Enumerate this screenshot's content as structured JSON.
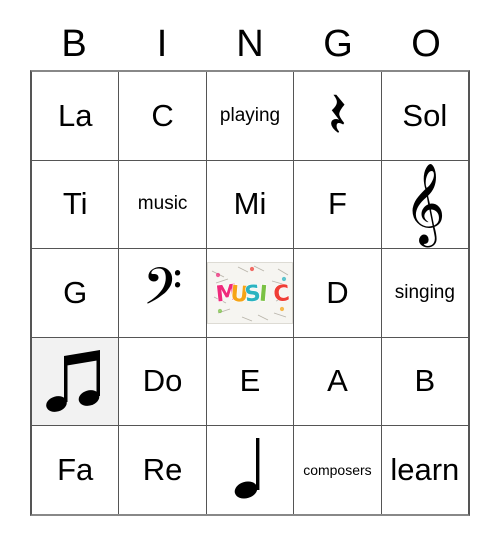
{
  "card": {
    "type": "bingo-card",
    "headers": [
      "B",
      "I",
      "N",
      "G",
      "O"
    ],
    "rows": [
      [
        {
          "kind": "text",
          "value": "La",
          "size": "large"
        },
        {
          "kind": "text",
          "value": "C",
          "size": "large"
        },
        {
          "kind": "text",
          "value": "playing",
          "size": "medium"
        },
        {
          "kind": "glyph",
          "value": "𝄽",
          "icon": "quarter-rest-icon",
          "label": "quarter rest"
        },
        {
          "kind": "text",
          "value": "Sol",
          "size": "large"
        }
      ],
      [
        {
          "kind": "text",
          "value": "Ti",
          "size": "large"
        },
        {
          "kind": "text",
          "value": "music",
          "size": "medium"
        },
        {
          "kind": "text",
          "value": "Mi",
          "size": "large"
        },
        {
          "kind": "text",
          "value": "F",
          "size": "large"
        },
        {
          "kind": "glyph",
          "value": "𝄞",
          "icon": "treble-clef-icon",
          "label": "treble clef"
        }
      ],
      [
        {
          "kind": "text",
          "value": "G",
          "size": "large"
        },
        {
          "kind": "glyph",
          "value": "𝄢",
          "icon": "bass-clef-icon",
          "label": "bass clef"
        },
        {
          "kind": "image",
          "value": "MUSIC",
          "icon": "music-word-art-image",
          "label": "colorful MUSIC word art"
        },
        {
          "kind": "text",
          "value": "D",
          "size": "large"
        },
        {
          "kind": "text",
          "value": "singing",
          "size": "medium"
        }
      ],
      [
        {
          "kind": "glyph",
          "value": "♫",
          "icon": "beamed-eighth-notes-icon",
          "label": "beamed eighth notes",
          "marked": true
        },
        {
          "kind": "text",
          "value": "Do",
          "size": "large"
        },
        {
          "kind": "text",
          "value": "E",
          "size": "large"
        },
        {
          "kind": "text",
          "value": "A",
          "size": "large"
        },
        {
          "kind": "text",
          "value": "B",
          "size": "large"
        }
      ],
      [
        {
          "kind": "text",
          "value": "Fa",
          "size": "large"
        },
        {
          "kind": "text",
          "value": "Re",
          "size": "large"
        },
        {
          "kind": "glyph",
          "value": "♩",
          "icon": "quarter-note-icon",
          "label": "quarter note"
        },
        {
          "kind": "text",
          "value": "composers",
          "size": "small"
        },
        {
          "kind": "text",
          "value": "learn",
          "size": "large"
        }
      ]
    ],
    "colors": {
      "background": "#ffffff",
      "grid_line": "#555555",
      "grid_outer": "#888888",
      "text": "#000000",
      "marked_cell": "#f2f2f2"
    },
    "music_art": {
      "word": "MUSIC",
      "letter_colors": [
        "#ef2a7b",
        "#f6a416",
        "#2bb3c0",
        "#7ac143",
        "#ef3e36"
      ],
      "backdrop": "#f6f5f1"
    }
  }
}
